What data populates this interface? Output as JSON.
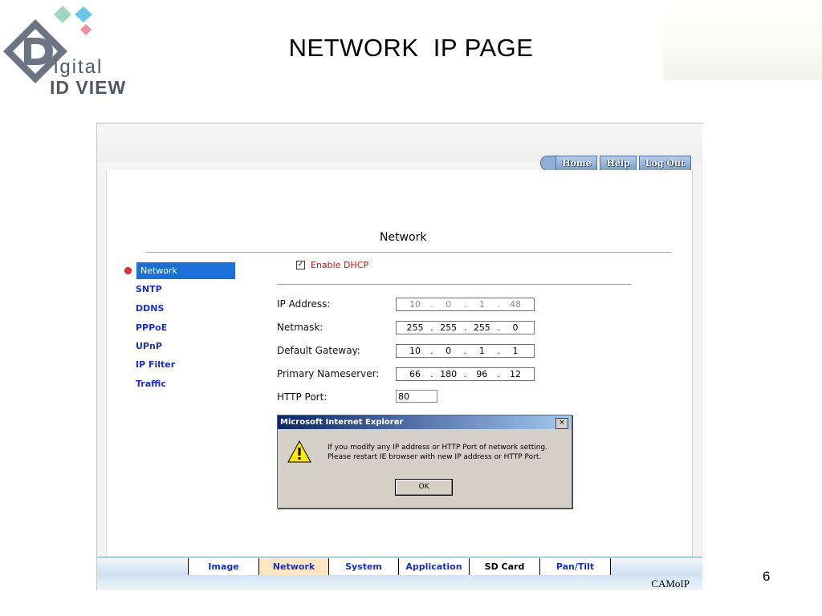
{
  "slide": {
    "title": "NETWORK  IP PAGE",
    "page_number": "6",
    "logo": {
      "line1": "igital",
      "line2": "ID VIEW"
    }
  },
  "app": {
    "nav_buttons": [
      "Home",
      "Help",
      "Log Out"
    ],
    "page_heading": "Network",
    "sidebar": {
      "items": [
        {
          "label": "Network",
          "active": true
        },
        {
          "label": "SNTP"
        },
        {
          "label": "DDNS"
        },
        {
          "label": "PPPoE"
        },
        {
          "label": "UPnP"
        },
        {
          "label": "IP Filter"
        },
        {
          "label": "Traffic"
        }
      ]
    },
    "form": {
      "enable_dhcp_label": "Enable DHCP",
      "enable_dhcp_checked": true,
      "ip_address": {
        "label": "IP Address:",
        "octets": [
          "10",
          "0",
          "1",
          "48"
        ]
      },
      "netmask": {
        "label": "Netmask:",
        "octets": [
          "255",
          "255",
          "255",
          "0"
        ]
      },
      "gateway": {
        "label": "Default Gateway:",
        "octets": [
          "10",
          "0",
          "1",
          "1"
        ]
      },
      "nameserver": {
        "label": "Primary Nameserver:",
        "octets": [
          "66",
          "180",
          "96",
          "12"
        ]
      },
      "http_port": {
        "label": "HTTP Port:",
        "value": "80"
      }
    },
    "dialog": {
      "title": "Microsoft Internet Explorer",
      "close": "×",
      "line1": "If you modify any IP address or HTTP Port of network setting.",
      "line2": "Please restart IE browser with new IP address or HTTP Port.",
      "ok_label": "OK"
    },
    "tabs": [
      "Image",
      "Network",
      "System",
      "Application",
      "SD Card",
      "Pan/Tilt"
    ],
    "brand": "CAMoIP"
  }
}
